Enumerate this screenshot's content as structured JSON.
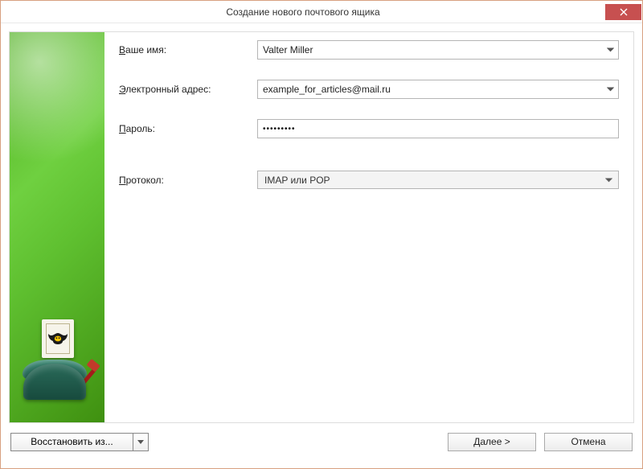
{
  "window": {
    "title": "Создание нового почтового ящика"
  },
  "form": {
    "name_label_pre": "В",
    "name_label_rest": "аше имя:",
    "name_value": "Valter Miller",
    "email_label_pre": "Э",
    "email_label_rest": "лектронный адрес:",
    "email_value": "example_for_articles@mail.ru",
    "password_label_pre": "П",
    "password_label_rest": "ароль:",
    "password_value": "•••••••••",
    "protocol_label_pre": "П",
    "protocol_label_rest": "ротокол:",
    "protocol_value": "IMAP или POP"
  },
  "footer": {
    "restore_label": "Восстановить из...",
    "next_label": "Далее   >",
    "cancel_label": "Отмена"
  }
}
